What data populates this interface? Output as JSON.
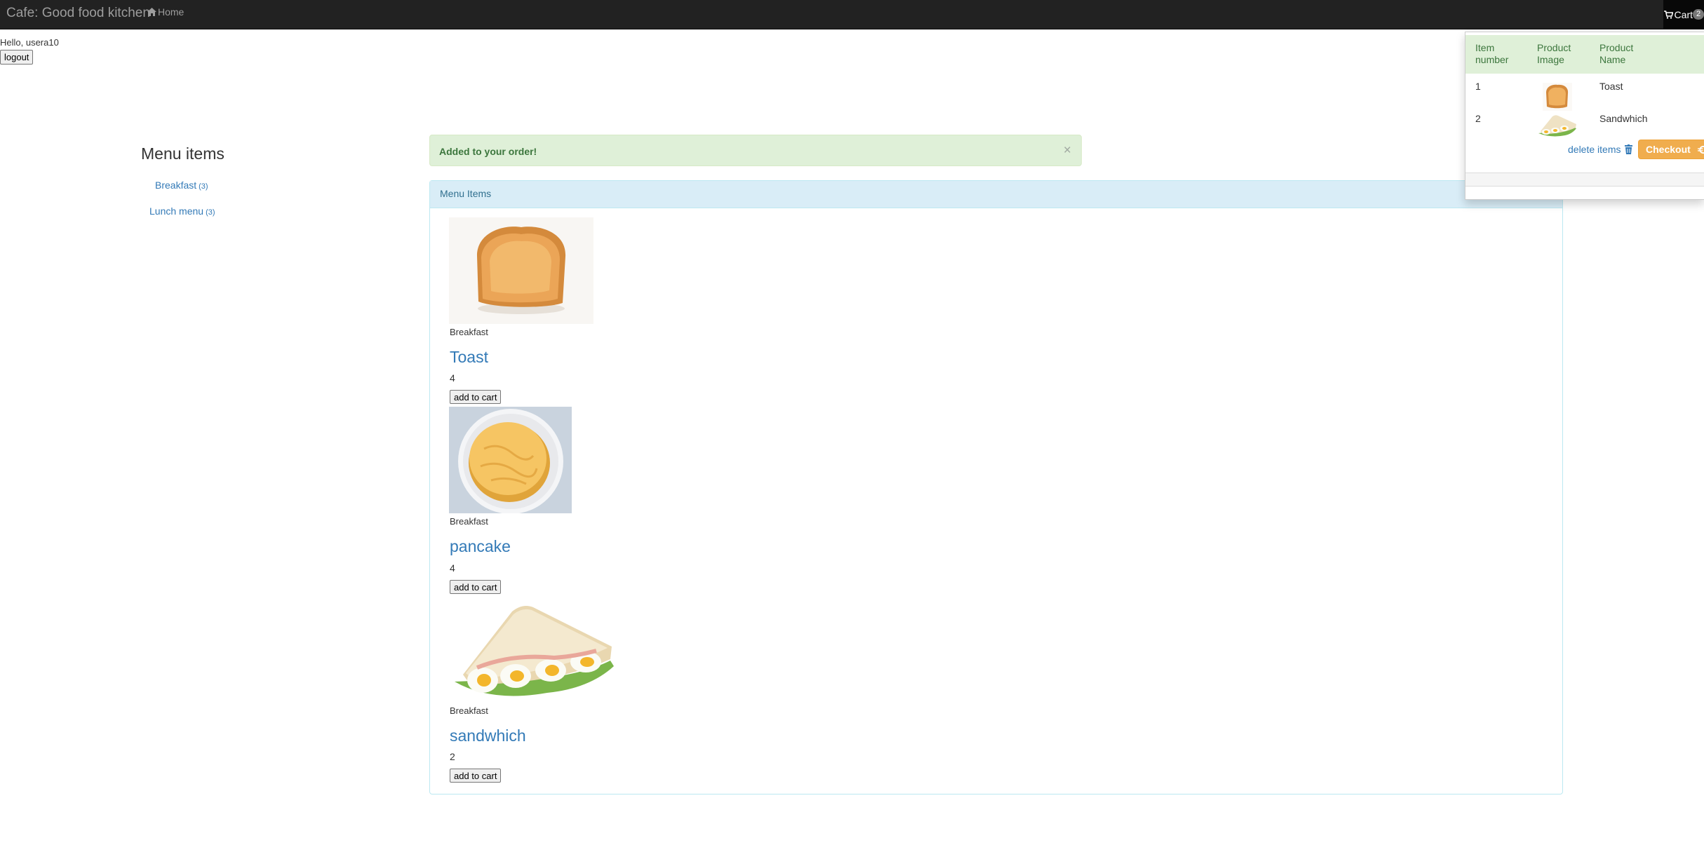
{
  "navbar": {
    "brand": "Cafe: Good food kitchen",
    "home_label": "Home",
    "home_icon": "home-icon",
    "cart_label": "Cart",
    "cart_icon": "shopping-cart-icon",
    "cart_count": "2"
  },
  "user": {
    "greeting": "Hello, usera10",
    "logout_label": "logout"
  },
  "sidebar": {
    "title": "Menu items",
    "categories": [
      {
        "label": "Breakfast",
        "count": "(3)"
      },
      {
        "label": "Lunch menu",
        "count": "(3)"
      }
    ]
  },
  "alert": {
    "message": "Added to your order!",
    "close": "×"
  },
  "panel": {
    "title": "Menu Items",
    "items": [
      {
        "category": "Breakfast",
        "name": "Toast",
        "price": "4",
        "button": "add to cart",
        "image_icon": "toast-image"
      },
      {
        "category": "Breakfast",
        "name": "pancake",
        "price": "4",
        "button": "add to cart",
        "image_icon": "pancake-image"
      },
      {
        "category": "Breakfast",
        "name": "sandwhich",
        "price": "2",
        "button": "add to cart",
        "image_icon": "sandwich-image"
      }
    ]
  },
  "cart": {
    "headers": {
      "item_number": "Item number",
      "product_image": "Product Image",
      "product_name": "Product Name"
    },
    "rows": [
      {
        "number": "1",
        "name": "Toast"
      },
      {
        "number": "2",
        "name": "Sandwhich"
      }
    ],
    "delete_label": "delete items",
    "delete_icon": "trash-icon",
    "checkout_label": "Checkout",
    "checkout_icon": "euro-icon"
  },
  "colors": {
    "navbar": "#222222",
    "link": "#337ab7",
    "alert_bg": "#dff0d8",
    "alert_text": "#3c763d",
    "panel_heading_bg": "#d9edf7",
    "checkout": "#f0ad4e"
  }
}
